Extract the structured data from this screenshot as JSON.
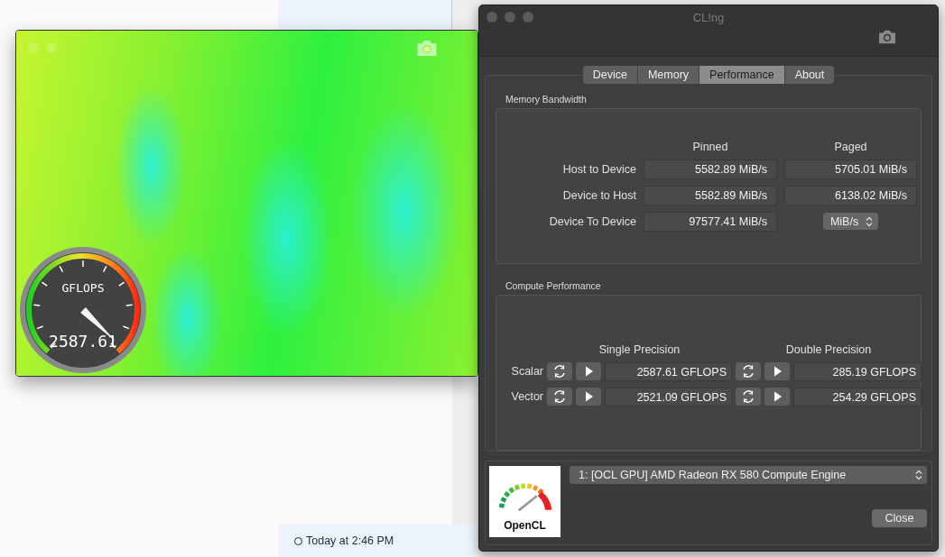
{
  "background": {
    "timestamp": "Today at 2:46 PM"
  },
  "gauge_window": {
    "gauge": {
      "label": "GFLOPS",
      "reading": "2587.61"
    }
  },
  "window": {
    "title": "CL!ng",
    "tabs": [
      {
        "label": "Device",
        "selected": false
      },
      {
        "label": "Memory",
        "selected": false
      },
      {
        "label": "Performance",
        "selected": true
      },
      {
        "label": "About",
        "selected": false
      }
    ],
    "memory_bandwidth": {
      "title": "Memory Bandwidth",
      "columns": [
        "Pinned",
        "Paged"
      ],
      "rows": [
        {
          "label": "Host to Device",
          "values": [
            "5582.89 MiB/s",
            "5705.01 MiB/s"
          ]
        },
        {
          "label": "Device to Host",
          "values": [
            "5582.89 MiB/s",
            "6138.02 MiB/s"
          ]
        },
        {
          "label": "Device To Device",
          "values": [
            "97577.41 MiB/s"
          ]
        }
      ],
      "unit_select": "MiB/s"
    },
    "compute_performance": {
      "title": "Compute Performance",
      "columns": [
        "Single Precision",
        "Double Precision"
      ],
      "rows": [
        {
          "label": "Scalar",
          "values": [
            "2587.61 GFLOPS",
            "285.19 GFLOPS"
          ]
        },
        {
          "label": "Vector",
          "values": [
            "2521.09 GFLOPS",
            "254.29 GFLOPS"
          ]
        }
      ]
    },
    "logo": {
      "label": "OpenCL"
    },
    "device_select": "1: [OCL GPU] AMD Radeon RX 580 Compute Engine",
    "close_button": "Close"
  }
}
